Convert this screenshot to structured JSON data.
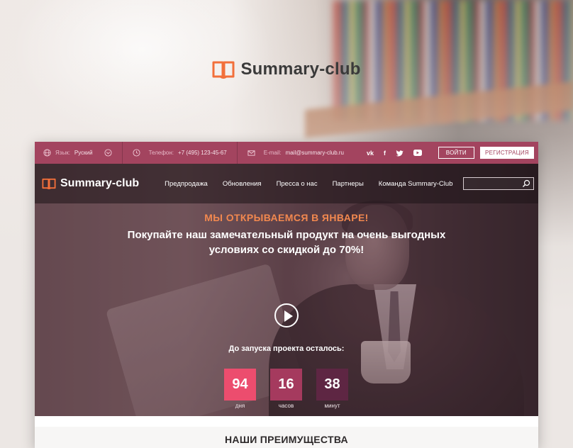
{
  "brand": {
    "name": "Summary-club",
    "accent": "#f26f3a"
  },
  "topbar": {
    "language_label": "Язык:",
    "language_value": "Руский",
    "phone_label": "Телефон:",
    "phone_value": "+7 (495) 123-45-67",
    "email_label": "E-mail:",
    "email_value": "mail@summary-club.ru",
    "social": [
      "vk",
      "f",
      "t",
      "yt"
    ],
    "login_label": "ВОЙТИ",
    "register_label": "РЕГИСТРАЦИЯ",
    "bg_color": "#a3445f"
  },
  "nav": {
    "logo_text": "Summary-club",
    "items": [
      "Предпродажа",
      "Обновления",
      "Пресса о нас",
      "Партнеры",
      "Команда Summary-Club"
    ],
    "search_placeholder": ""
  },
  "hero": {
    "headline": "МЫ ОТКРЫВАЕМСЯ В ЯНВАРЕ!",
    "subline": "Покупайте наш замечательный продукт на очень выгодных условиях со скидкой до 70%!",
    "countdown_title": "До запуска проекта осталось:",
    "counters": [
      {
        "value": "94",
        "label": "дня",
        "color": "#ec4d6e"
      },
      {
        "value": "16",
        "label": "часов",
        "color": "#a53a5e"
      },
      {
        "value": "38",
        "label": "минут",
        "color": "#5e2643"
      }
    ],
    "slides": 3,
    "active_slide": 1
  },
  "section": {
    "title": "НАШИ ПРЕИМУЩЕСТВА"
  }
}
